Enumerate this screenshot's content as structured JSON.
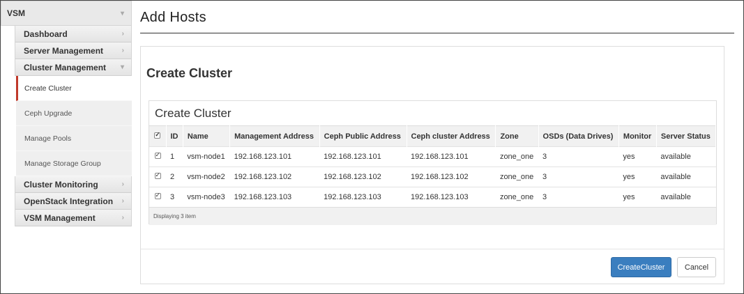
{
  "sidebar": {
    "root_label": "VSM",
    "groups_top": [
      {
        "label": "Dashboard",
        "chevron": "chevron-right-icon"
      },
      {
        "label": "Server Management",
        "chevron": "chevron-right-icon"
      },
      {
        "label": "Cluster Management",
        "chevron": "chevron-down-icon"
      }
    ],
    "subitems": [
      {
        "label": "Create Cluster",
        "active": true
      },
      {
        "label": "Ceph Upgrade"
      },
      {
        "label": "Manage Pools"
      },
      {
        "label": "Manage Storage Group"
      }
    ],
    "groups_bottom": [
      {
        "label": "Cluster Monitoring"
      },
      {
        "label": "OpenStack Integration"
      },
      {
        "label": "VSM Management"
      }
    ]
  },
  "page": {
    "title": "Add Hosts",
    "panel_title": "Create Cluster",
    "table_title": "Create Cluster"
  },
  "table": {
    "headers": [
      "ID",
      "Name",
      "Management Address",
      "Ceph Public Address",
      "Ceph cluster Address",
      "Zone",
      "OSDs (Data Drives)",
      "Monitor",
      "Server Status"
    ],
    "rows": [
      [
        "1",
        "vsm-node1",
        "192.168.123.101",
        "192.168.123.101",
        "192.168.123.101",
        "zone_one",
        "3",
        "yes",
        "available"
      ],
      [
        "2",
        "vsm-node2",
        "192.168.123.102",
        "192.168.123.102",
        "192.168.123.102",
        "zone_one",
        "3",
        "yes",
        "available"
      ],
      [
        "3",
        "vsm-node3",
        "192.168.123.103",
        "192.168.123.103",
        "192.168.123.103",
        "zone_one",
        "3",
        "yes",
        "available"
      ]
    ],
    "footer": "Displaying 3 item"
  },
  "buttons": {
    "create": "CreateCluster",
    "cancel": "Cancel"
  },
  "colors": {
    "primary": "#3a7ebf",
    "active_marker": "#c0392b"
  }
}
